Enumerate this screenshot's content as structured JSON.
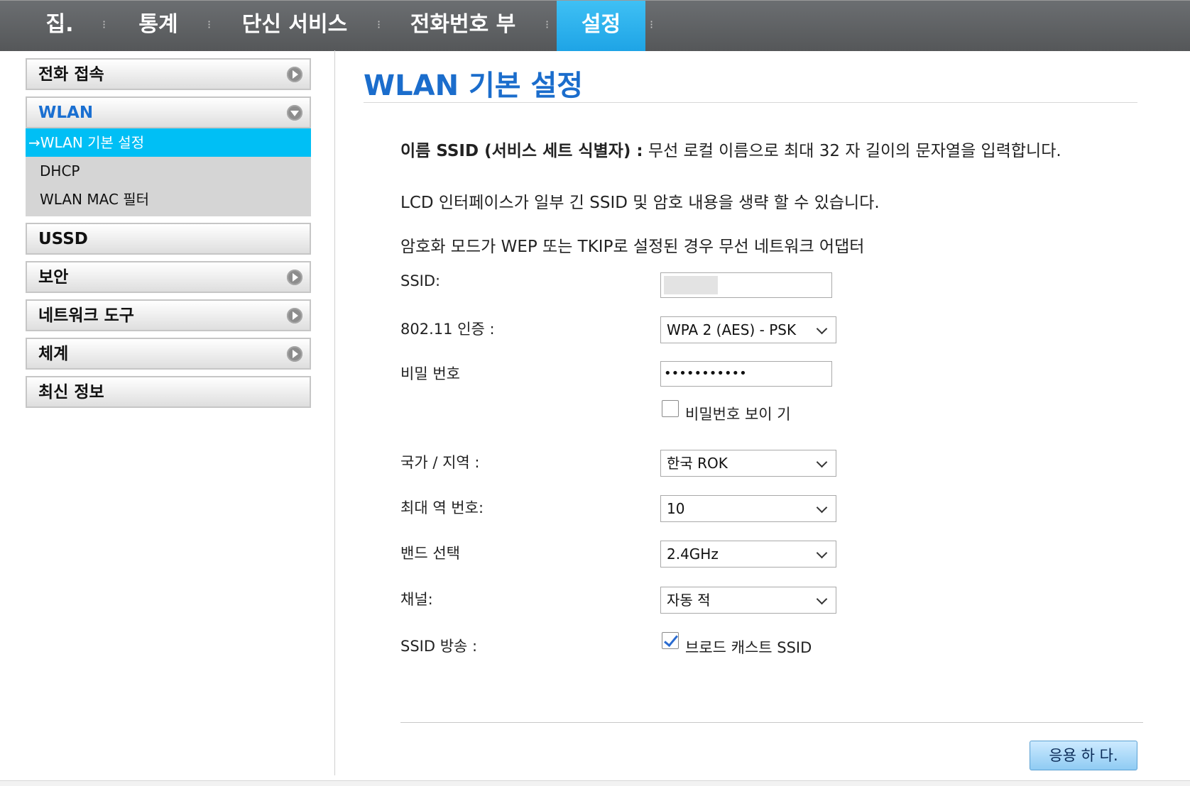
{
  "nav": {
    "items": [
      {
        "label": "집."
      },
      {
        "label": "통계"
      },
      {
        "label": "단신 서비스"
      },
      {
        "label": "전화번호 부"
      },
      {
        "label": "설정",
        "active": true
      }
    ]
  },
  "sidebar": {
    "menus": [
      {
        "label": "전화 접속",
        "icon": "arrow-right-icon"
      },
      {
        "label": "WLAN",
        "icon": "arrow-down-icon",
        "open": true
      },
      {
        "label": "USSD"
      },
      {
        "label": "보안",
        "icon": "arrow-right-icon"
      },
      {
        "label": "네트워크 도구",
        "icon": "arrow-right-icon"
      },
      {
        "label": "체계",
        "icon": "arrow-right-icon"
      },
      {
        "label": "최신 정보"
      }
    ],
    "wlan_sub": [
      {
        "label": "→WLAN 기본 설정",
        "active": true
      },
      {
        "label": "DHCP"
      },
      {
        "label": "WLAN MAC 필터"
      }
    ]
  },
  "main": {
    "title": "WLAN 기본 설정",
    "desc1_bold": "이름 SSID (서비스 세트 식별자) :",
    "desc1_rest": " 무선 로컬 이름으로 최대 32 자 길이의 문자열을 입력합니다.",
    "desc2": "LCD 인터페이스가 일부 긴 SSID 및 암호 내용을 생략 할 수 있습니다.",
    "desc3": "암호화 모드가 WEP 또는 TKIP로 설정된 경우 무선 네트워크 어댑터",
    "fields": {
      "ssid_label": "SSID:",
      "auth_label": "802.11 인증 :",
      "auth_value": "WPA 2 (AES) - PSK",
      "password_label": "비밀 번호",
      "password_value": "•••••••••••",
      "show_password_label": "비밀번호 보이 기",
      "show_password_checked": false,
      "country_label": "국가 / 지역 :",
      "country_value": "한국 ROK",
      "max_channel_label": "최대 역 번호:",
      "max_channel_value": "10",
      "band_label": "밴드 선택",
      "band_value": "2.4GHz",
      "channel_label": "채널:",
      "channel_value": "자동 적",
      "broadcast_label": "SSID 방송 :",
      "broadcast_checkbox_label": "브로드 캐스트 SSID",
      "broadcast_checked": true
    },
    "apply_label": "응용 하 다."
  },
  "colors": {
    "accent": "#1b6dcc",
    "active_tab": "#1ea4e6",
    "active_sub": "#00bff5",
    "topbar": "#5f6265"
  }
}
